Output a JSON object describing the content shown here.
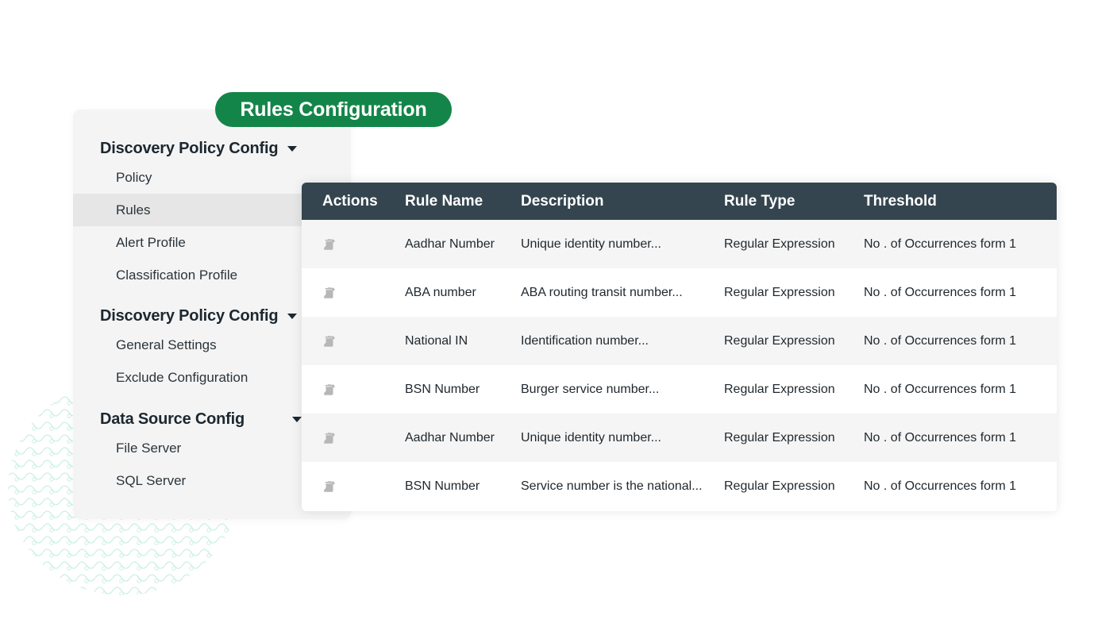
{
  "title": "Rules Configuration",
  "colors": {
    "accent": "#148549",
    "header_bg": "#35454f",
    "sidebar_bg": "#f4f4f4",
    "active_item_bg": "#e6e6e6",
    "row_shade": "#f5f5f5",
    "icon_grey": "#b7b7b7"
  },
  "sidebar": {
    "sections": [
      {
        "heading": "Discovery Policy Config",
        "icon": "caret-down-icon",
        "items": [
          "Policy",
          "Rules",
          "Alert Profile",
          "Classification Profile"
        ]
      },
      {
        "heading": "Discovery Policy Config",
        "icon": "caret-down-icon",
        "items": [
          "General Settings",
          "Exclude Configuration"
        ]
      },
      {
        "heading": "Data Source Config",
        "icon": "caret-down-icon",
        "items": [
          "File Server",
          "SQL Server"
        ]
      }
    ],
    "active_item": "Rules"
  },
  "table": {
    "columns": [
      "Actions",
      "Rule Name",
      "Description",
      "Rule Type",
      "Threshold"
    ],
    "action_icons": [
      "edit-pencil-icon",
      "delete-trash-icon"
    ],
    "rows": [
      {
        "name": "Aadhar Number",
        "description": "Unique identity number...",
        "type": "Regular Expression",
        "threshold": "No . of Occurrences form 1"
      },
      {
        "name": "ABA number",
        "description": "ABA routing transit number...",
        "type": "Regular Expression",
        "threshold": "No . of Occurrences form 1"
      },
      {
        "name": "National IN",
        "description": "Identification number...",
        "type": "Regular Expression",
        "threshold": "No . of Occurrences form 1"
      },
      {
        "name": "BSN Number",
        "description": "Burger service number...",
        "type": "Regular Expression",
        "threshold": "No . of Occurrences form 1"
      },
      {
        "name": "Aadhar Number",
        "description": "Unique identity number...",
        "type": "Regular Expression",
        "threshold": "No . of Occurrences form 1"
      },
      {
        "name": "BSN Number",
        "description": "Service number is the national...",
        "type": "Regular Expression",
        "threshold": "No . of Occurrences form 1"
      }
    ]
  }
}
